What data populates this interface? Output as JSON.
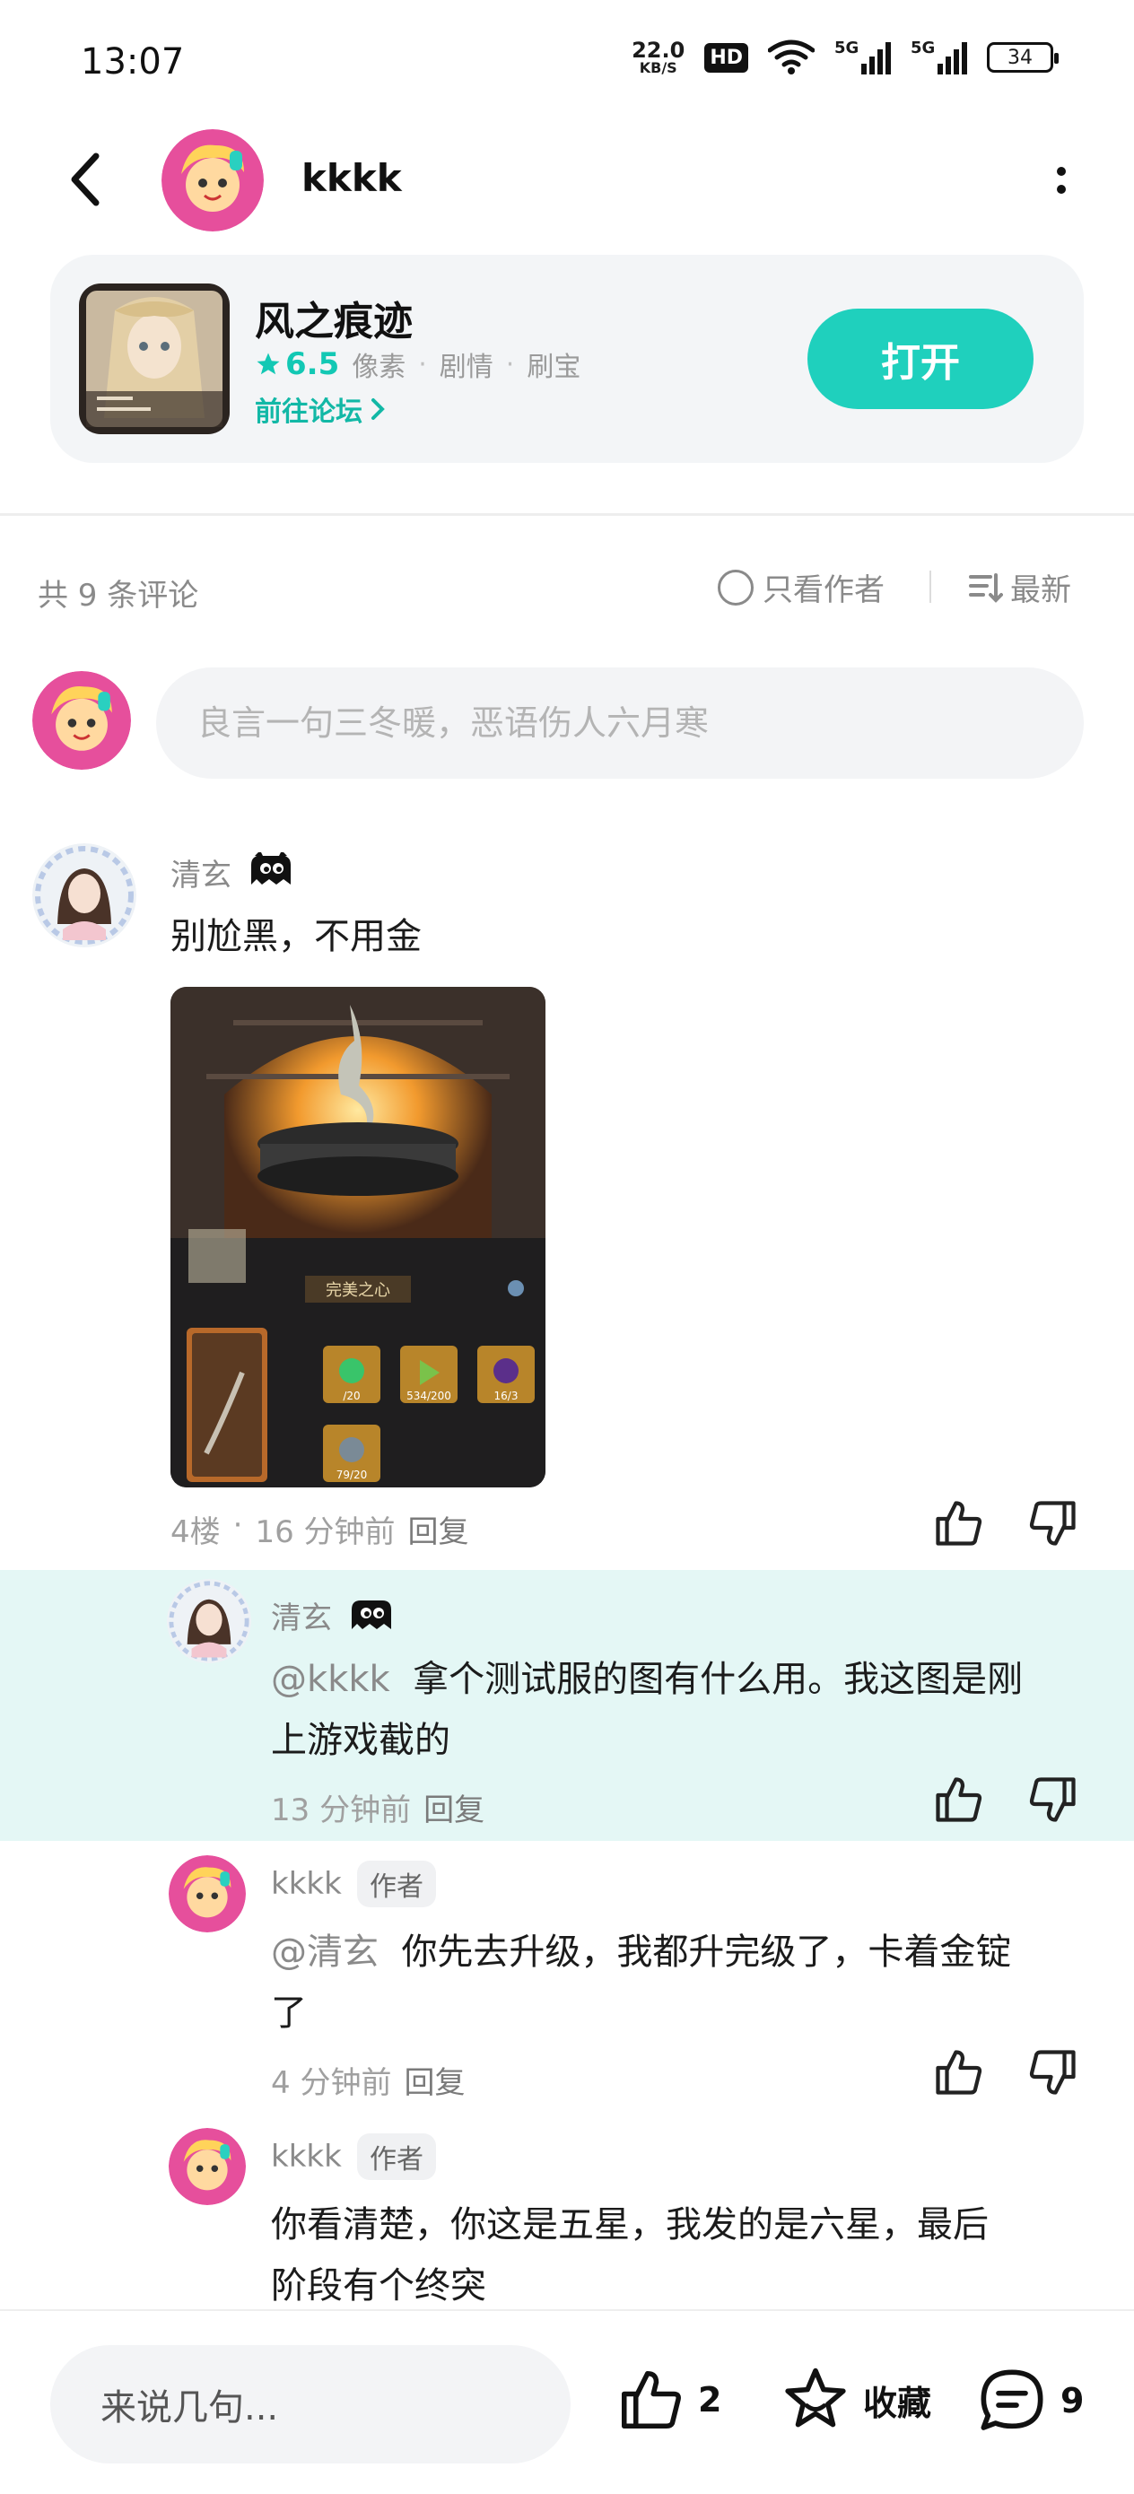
{
  "status_bar": {
    "time": "13:07",
    "net_speed_value": "22.0",
    "net_speed_unit": "KB/S",
    "hd_label": "HD",
    "signal_1_label": "5G",
    "signal_2_label": "5G",
    "battery": "34"
  },
  "header": {
    "username": "kkkk"
  },
  "game": {
    "title": "风之痕迹",
    "rating": "6.5",
    "tags": [
      "像素",
      "剧情",
      "刷宝"
    ],
    "forum_link": "前往论坛",
    "open_button": "打开"
  },
  "comments_header": {
    "count_text": "共 9 条评论",
    "only_author": "只看作者",
    "sort": "最新"
  },
  "comment_input": {
    "placeholder": "良言一句三冬暖，恶语伤人六月寒"
  },
  "comments": [
    {
      "user": "清玄",
      "text": "别尬黑，不用金",
      "floor": "4楼",
      "time": "16 分钟前",
      "reply": "回复",
      "image": {
        "title": "完美之心",
        "counts": [
          "/20",
          "534/200",
          "16/3",
          "79/20"
        ]
      }
    },
    {
      "user": "清玄",
      "mention": "@kkkk",
      "text_line1": "拿个测试服的图有什么用。我这图是刚",
      "text_line2": "上游戏截的",
      "time": "13 分钟前",
      "reply": "回复"
    },
    {
      "user": "kkkk",
      "author_tag": "作者",
      "mention": "@清玄",
      "text_line1": "你先去升级，我都升完级了，卡着金锭",
      "text_line2": "了",
      "time": "4 分钟前",
      "reply": "回复"
    },
    {
      "user": "kkkk",
      "author_tag": "作者",
      "text_line1": "你看清楚，你这是五星，我发的是六星，最后",
      "text_line2": "阶段有个终突"
    }
  ],
  "bottom_bar": {
    "input_placeholder": "来说几句...",
    "like_count": "2",
    "collect_label": "收藏",
    "comment_count": "9"
  },
  "colors": {
    "accent": "#1fd0bd",
    "highlight_bg": "#e4f7f5",
    "card_bg": "#f3f5f7"
  }
}
